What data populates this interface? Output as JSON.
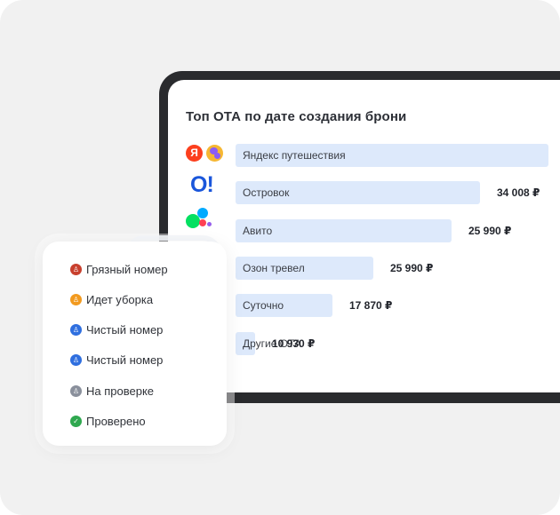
{
  "panel": {
    "title": "Топ ОТА по дате создания брони",
    "logos": [
      "yandex-icon",
      "yandex-travel-icon",
      "ostrovok-icon",
      "avito-icon"
    ],
    "ostrovok_logo_text": "O!",
    "yandex_logo_text": "Я"
  },
  "chart_data": {
    "type": "bar",
    "orientation": "horizontal",
    "title": "Топ ОТА по дате создания брони",
    "categories": [
      "Яндекс путешествия",
      "Островок",
      "Авито",
      "Озон тревел",
      "Суточно",
      "Другие ОТА"
    ],
    "values": [
      null,
      34008,
      25990,
      25990,
      17870,
      10930
    ],
    "value_labels": [
      "",
      "34 008 ₽",
      "25 990 ₽",
      "25 990 ₽",
      "17 870 ₽",
      "10 930 ₽"
    ],
    "relative_fill": [
      1.0,
      0.78,
      0.69,
      0.44,
      0.31,
      0.06
    ],
    "bar_color": "#dde9fb"
  },
  "status_card": {
    "items": [
      {
        "label": "Грязный номер",
        "icon": "broom-icon",
        "color": "#c8402e"
      },
      {
        "label": "Идет уборка",
        "icon": "broom-icon",
        "color": "#f29a1f"
      },
      {
        "label": "Чистый номер",
        "icon": "broom-icon",
        "color": "#2f6fdf"
      },
      {
        "label": "Чистый номер",
        "icon": "broom-icon",
        "color": "#2f6fdf"
      },
      {
        "label": "На проверке",
        "icon": "broom-icon",
        "color": "#8a909c"
      },
      {
        "label": "Проверено",
        "icon": "check-icon",
        "color": "#2fa84f"
      }
    ]
  }
}
